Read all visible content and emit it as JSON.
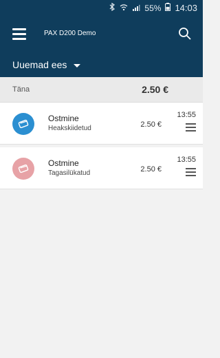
{
  "status": {
    "battery_percent": "55%",
    "time": "14:03"
  },
  "appbar": {
    "title": "PAX D200 Demo"
  },
  "filter": {
    "selected": "Uuemad ees"
  },
  "summary": {
    "label": "Täna",
    "total": "2.50 €"
  },
  "colors": {
    "primary": "#0f3d5c",
    "approved": "#2b8fd1",
    "rejected": "#e7a2a6"
  },
  "transactions": [
    {
      "title": "Ostmine",
      "status": "Heakskiidetud",
      "amount": "2.50 €",
      "time": "13:55",
      "status_color": "#2b8fd1",
      "icon": "card-icon"
    },
    {
      "title": "Ostmine",
      "status": "Tagasilükatud",
      "amount": "2.50 €",
      "time": "13:55",
      "status_color": "#e7a2a6",
      "icon": "card-icon"
    }
  ]
}
